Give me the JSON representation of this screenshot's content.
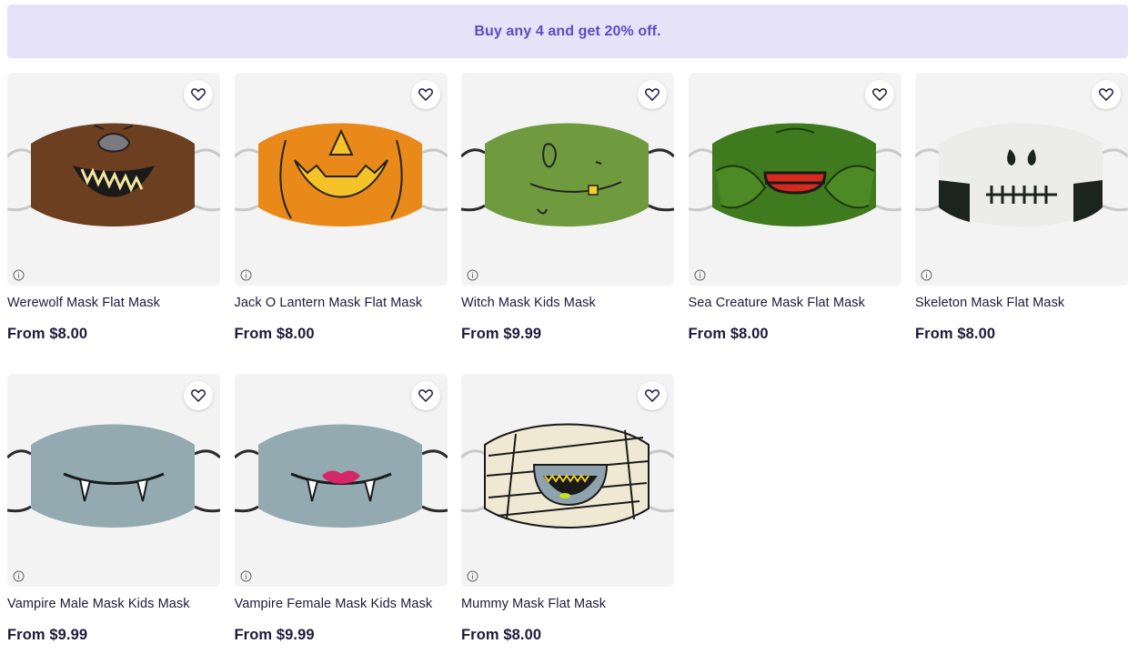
{
  "promo": {
    "text": "Buy any 4 and get 20% off."
  },
  "products": [
    {
      "title": "Werewolf Mask Flat Mask",
      "price": "From $8.00",
      "icon": "werewolf-mask"
    },
    {
      "title": "Jack O Lantern Mask Flat Mask",
      "price": "From $8.00",
      "icon": "jack-o-lantern-mask"
    },
    {
      "title": "Witch Mask Kids Mask",
      "price": "From $9.99",
      "icon": "witch-mask"
    },
    {
      "title": "Sea Creature Mask Flat Mask",
      "price": "From $8.00",
      "icon": "sea-creature-mask"
    },
    {
      "title": "Skeleton Mask Flat Mask",
      "price": "From $8.00",
      "icon": "skeleton-mask"
    },
    {
      "title": "Vampire Male Mask Kids Mask",
      "price": "From $9.99",
      "icon": "vampire-male-mask"
    },
    {
      "title": "Vampire Female Mask Kids Mask",
      "price": "From $9.99",
      "icon": "vampire-female-mask"
    },
    {
      "title": "Mummy Mask Flat Mask",
      "price": "From $8.00",
      "icon": "mummy-mask"
    }
  ],
  "colors": {
    "promo_bg": "#e6e3f8",
    "promo_text": "#5b4bc4",
    "text": "#1d1a3a",
    "werewolf": "#6b3f1f",
    "pumpkin": "#e8891a",
    "witch": "#6f9a3e",
    "sea_creature": "#3f7a1e",
    "skeleton": "#ececea",
    "vampire": "#93aab0",
    "mummy": "#efe9d4"
  }
}
